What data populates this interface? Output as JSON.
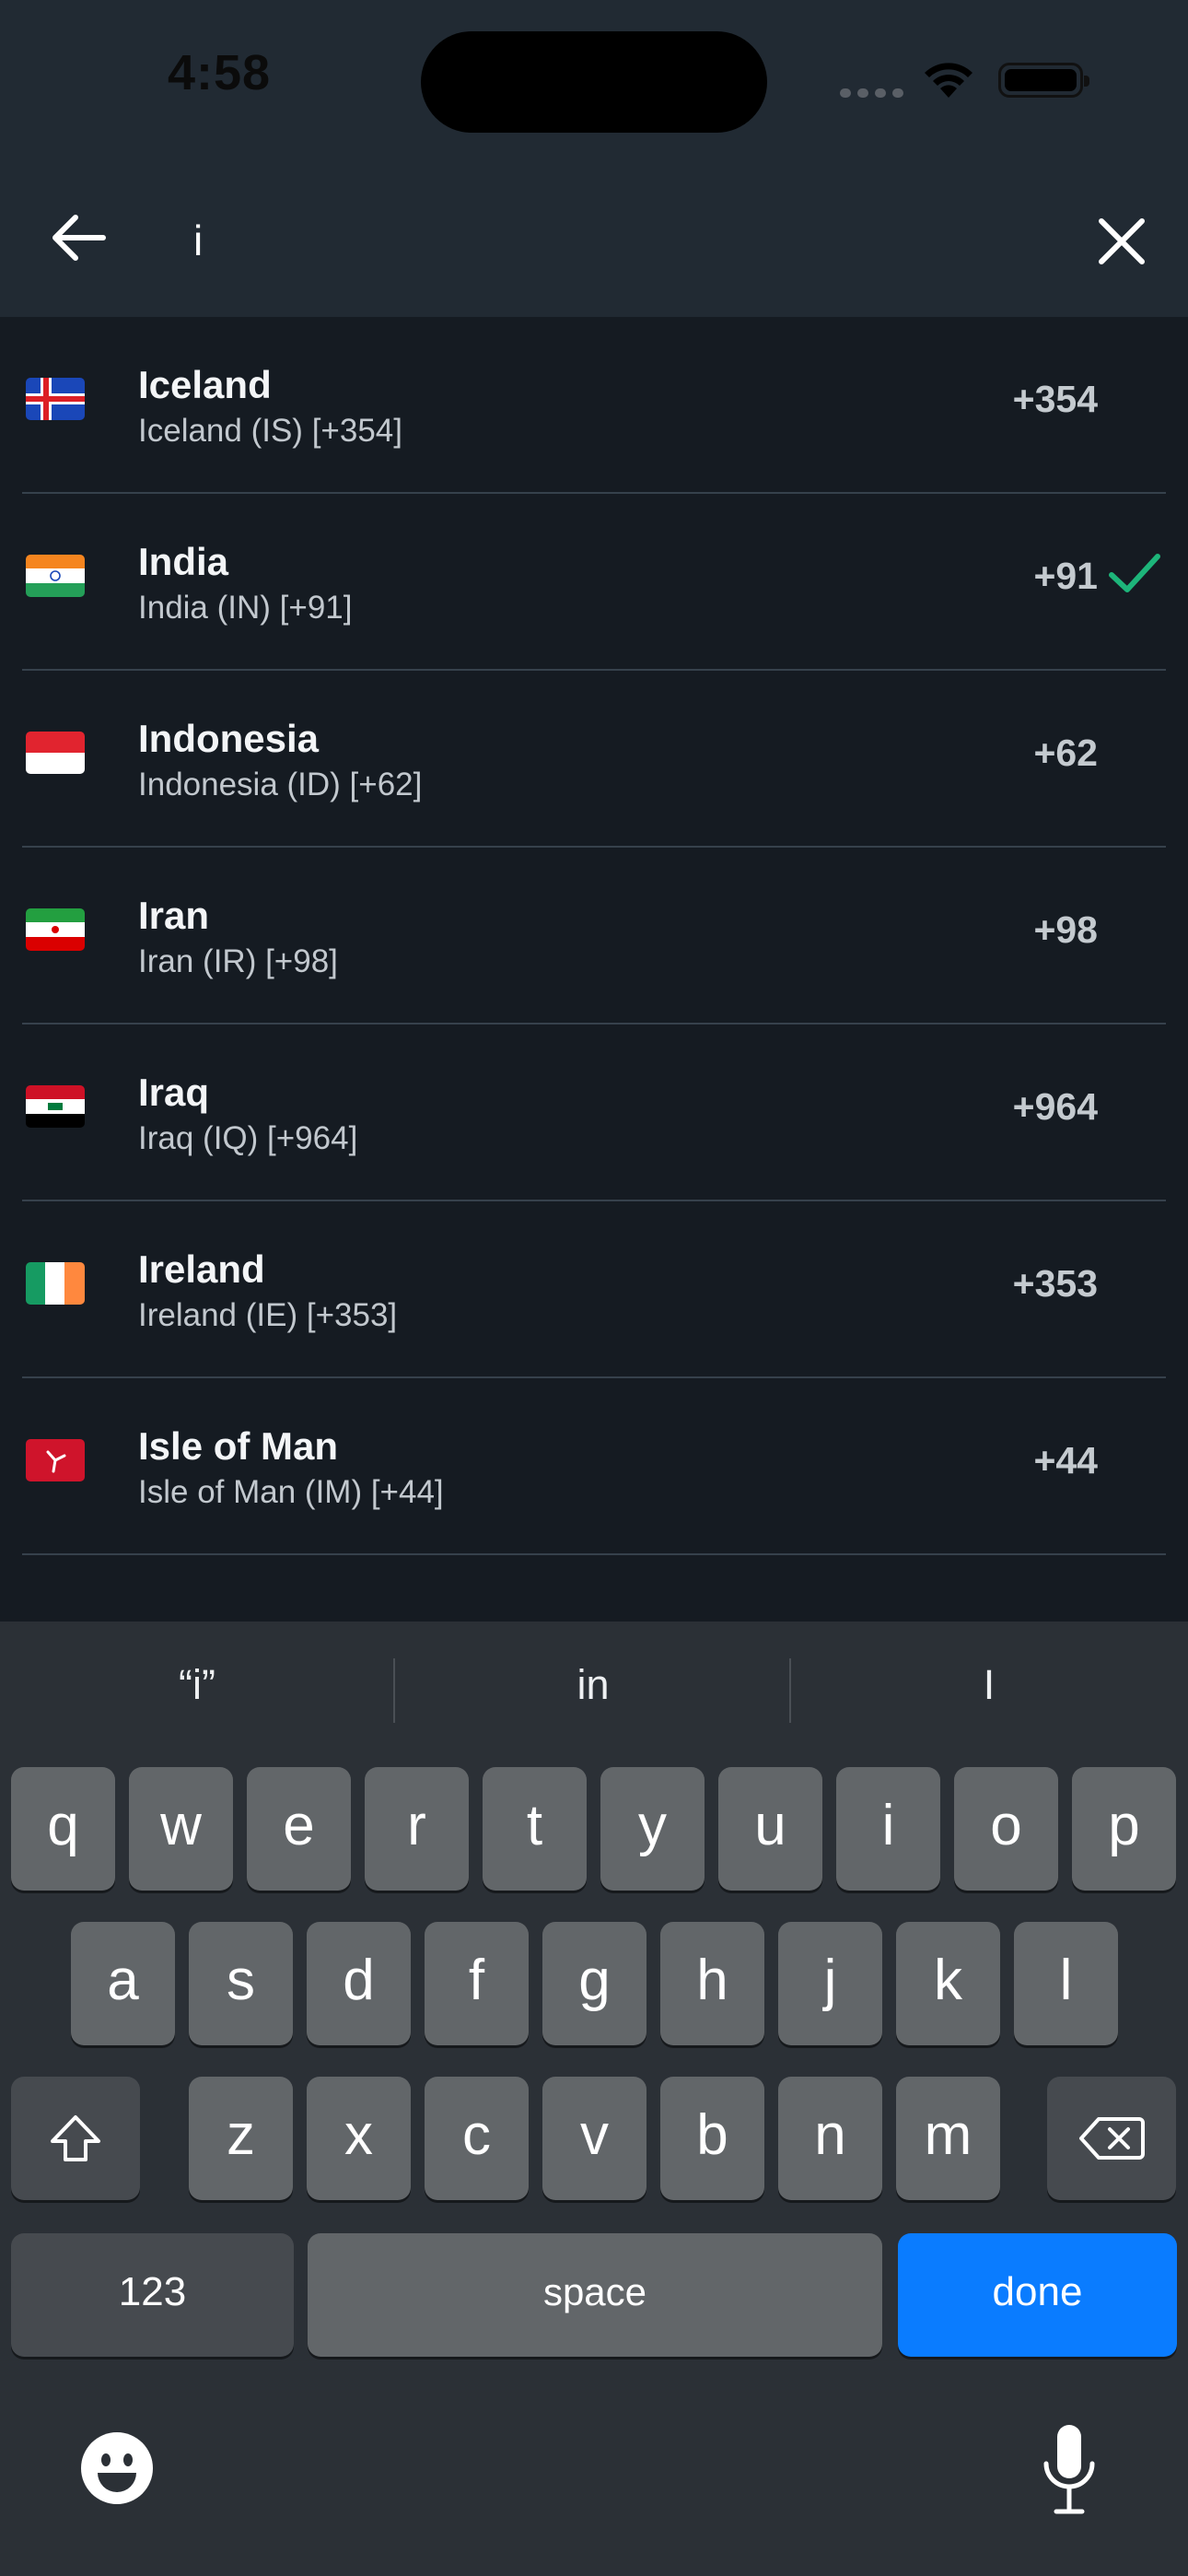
{
  "status_bar": {
    "time": "4:58"
  },
  "search": {
    "query": "i",
    "placeholder": ""
  },
  "countries": [
    {
      "name": "Iceland",
      "subtitle": "Iceland (IS) [+354]",
      "code": "+354",
      "flag": "iceland-flag",
      "selected": false
    },
    {
      "name": "India",
      "subtitle": "India (IN) [+91]",
      "code": "+91",
      "flag": "india-flag",
      "selected": true
    },
    {
      "name": "Indonesia",
      "subtitle": "Indonesia (ID) [+62]",
      "code": "+62",
      "flag": "indonesia-flag",
      "selected": false
    },
    {
      "name": "Iran",
      "subtitle": "Iran (IR) [+98]",
      "code": "+98",
      "flag": "iran-flag",
      "selected": false
    },
    {
      "name": "Iraq",
      "subtitle": "Iraq (IQ) [+964]",
      "code": "+964",
      "flag": "iraq-flag",
      "selected": false
    },
    {
      "name": "Ireland",
      "subtitle": "Ireland (IE) [+353]",
      "code": "+353",
      "flag": "ireland-flag",
      "selected": false
    },
    {
      "name": "Isle of Man",
      "subtitle": "Isle of Man (IM) [+44]",
      "code": "+44",
      "flag": "isle-of-man-flag",
      "selected": false
    }
  ],
  "keyboard": {
    "suggestions": [
      "“i”",
      "in",
      "I"
    ],
    "row1": [
      "q",
      "w",
      "e",
      "r",
      "t",
      "y",
      "u",
      "i",
      "o",
      "p"
    ],
    "row2": [
      "a",
      "s",
      "d",
      "f",
      "g",
      "h",
      "j",
      "k",
      "l"
    ],
    "row3": [
      "z",
      "x",
      "c",
      "v",
      "b",
      "n",
      "m"
    ],
    "numbers_label": "123",
    "space_label": "space",
    "done_label": "done"
  },
  "colors": {
    "accent_check": "#1db57a",
    "done_key": "#0a7cff",
    "list_background": "#151b22",
    "header_background": "#212a33"
  }
}
